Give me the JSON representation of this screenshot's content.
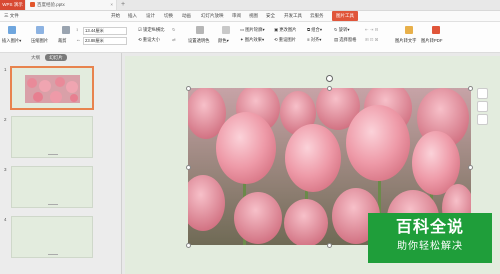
{
  "titlebar": {
    "app_tab": "WPS 演示",
    "doc_tab": "百度经验.pptx",
    "close_glyph": "×",
    "new_tab_glyph": "+"
  },
  "menu": {
    "items": [
      "三 文件",
      "开始",
      "插入",
      "设计",
      "切换",
      "动画",
      "幻灯片放映",
      "审阅",
      "视图",
      "安全",
      "开发工具",
      "云服务"
    ],
    "picture_tools": "图片工具"
  },
  "toolbar": {
    "insert_picture": "插入图片▾",
    "compress": "压缩图片",
    "clear": "裁剪",
    "height_value": "13.44厘米",
    "width_value": "23.88厘米",
    "lock_ratio": "锁定纵横比",
    "reset_size": "重设大小",
    "set_transparent": "设置透明色",
    "color": "颜色▾",
    "picture_outline": "图片轮廓▾",
    "picture_effect": "图片效果▾",
    "change_picture": "更改图片",
    "reset_picture": "重设图片",
    "combine": "组合▾",
    "align": "对齐▾",
    "rotate": "旋转▾",
    "select_pane": "选择窗格",
    "picture_to_text": "图片转文字",
    "picture_to_pdf": "图片转PDF"
  },
  "panel": {
    "tab_outline": "大纲",
    "tab_slides": "幻灯片",
    "slide_numbers": [
      "1",
      "2",
      "3",
      "4"
    ]
  },
  "watermark": {
    "line1": "百科全说",
    "line2": "助你轻松解决"
  },
  "colors": {
    "accent": "#d84a33",
    "slide_bg": "#e3ecde",
    "watermark_green": "#1f9e3a",
    "tulip_pink": "#e98a99"
  }
}
